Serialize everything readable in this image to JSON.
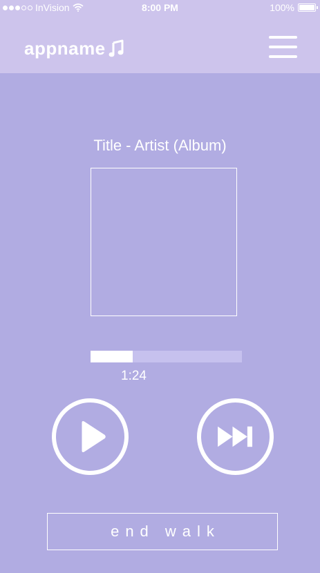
{
  "status_bar": {
    "carrier": "InVision",
    "time": "8:00 PM",
    "battery": "100%",
    "signal_bars_filled": 3,
    "signal_bars_total": 5
  },
  "header": {
    "app_name": "appname",
    "logo_icon": "music-note-icon",
    "menu_icon": "hamburger-menu-icon"
  },
  "player": {
    "track_title": "Title - Artist (Album)",
    "elapsed": "1:24",
    "progress_fraction": 0.28,
    "play_icon": "play-icon",
    "skip_icon": "fast-forward-icon"
  },
  "actions": {
    "end_walk_label": "end walk"
  },
  "colors": {
    "header_background": "#cdc4ec",
    "page_background": "#b1ace2",
    "progress_track": "#c6c1ee",
    "foreground": "#ffffff"
  }
}
